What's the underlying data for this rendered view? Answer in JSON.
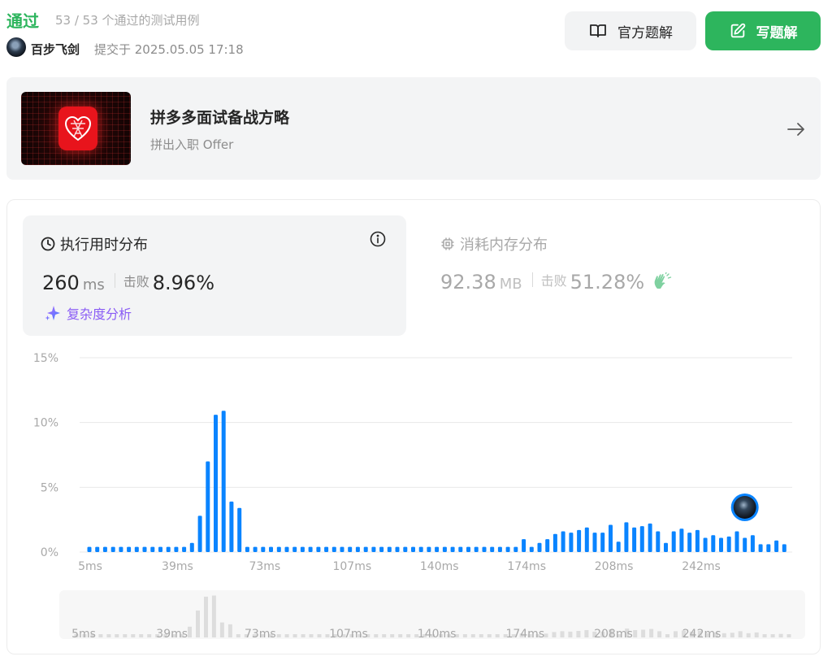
{
  "header": {
    "status": "通过",
    "cases": "53 / 53 个通过的测试用例",
    "username": "百步飞剑",
    "submitted": "提交于 2025.05.05 17:18",
    "official_btn": "官方题解",
    "write_btn": "写题解"
  },
  "promo": {
    "title": "拼多多面试备战方略",
    "subtitle": "拼出入职 Offer"
  },
  "runtime": {
    "title": "执行用时分布",
    "value": "260",
    "unit": "ms",
    "beat_label": "击败",
    "beat_value": "8.96%",
    "complexity": "复杂度分析"
  },
  "memory": {
    "title": "消耗内存分布",
    "value": "92.38",
    "unit": "MB",
    "beat_label": "击败",
    "beat_value": "51.28%"
  },
  "colors": {
    "accent_green": "#2db55d",
    "bar_blue": "#0a84ff",
    "complexity_purple": "#8a5cf5"
  },
  "chart_data": {
    "type": "bar",
    "ylabel": "",
    "xlabel": "",
    "ylim": [
      0,
      15
    ],
    "y_ticks": [
      "15%",
      "10%",
      "5%",
      "0%"
    ],
    "x_tick_labels": [
      "5ms",
      "39ms",
      "73ms",
      "107ms",
      "140ms",
      "174ms",
      "208ms",
      "242ms"
    ],
    "values": [
      0.4,
      0.4,
      0.4,
      0.4,
      0.4,
      0.4,
      0.4,
      0.4,
      0.4,
      0.4,
      0.4,
      0.4,
      0.4,
      0.7,
      2.8,
      7.0,
      10.6,
      10.9,
      3.9,
      3.4,
      0.4,
      0.4,
      0.4,
      0.4,
      0.4,
      0.4,
      0.4,
      0.4,
      0.4,
      0.4,
      0.4,
      0.4,
      0.4,
      0.4,
      0.4,
      0.4,
      0.4,
      0.4,
      0.4,
      0.4,
      0.4,
      0.4,
      0.4,
      0.4,
      0.4,
      0.4,
      0.4,
      0.4,
      0.4,
      0.4,
      0.4,
      0.4,
      0.4,
      0.4,
      0.4,
      1.0,
      0.4,
      0.7,
      1.0,
      1.4,
      1.6,
      1.5,
      1.7,
      1.9,
      1.5,
      1.5,
      2.1,
      0.8,
      2.3,
      1.9,
      2.0,
      2.2,
      1.6,
      0.7,
      1.6,
      1.8,
      1.5,
      1.7,
      1.1,
      1.3,
      1.1,
      1.2,
      1.6,
      1.1,
      1.3,
      0.6,
      0.6,
      0.9,
      0.6
    ],
    "highlight_index": 83,
    "grid": true
  }
}
